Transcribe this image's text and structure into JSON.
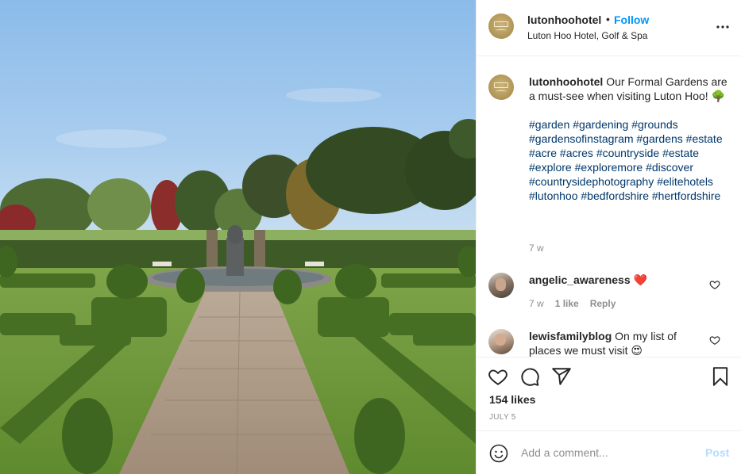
{
  "post": {
    "username": "lutonhoohotel",
    "follow_separator": "•",
    "follow_label": "Follow",
    "location": "Luton Hoo Hotel, Golf & Spa",
    "more_icon": "more-horizontal-icon"
  },
  "caption": {
    "username": "lutonhoohotel",
    "text": "Our Formal Gardens are a must-see when visiting Luton Hoo! 🌳",
    "hashtags": "#garden #gardening #grounds #gardensofinstagram #gardens #estate #acre #acres #countryside #estate #explore #exploremore #discover #countrysidephotography #elitehotels #lutonhoo #bedfordshire #hertfordshire",
    "time": "7 w"
  },
  "comments": [
    {
      "username": "angelic_awareness",
      "text": "❤️",
      "time": "7 w",
      "likes": "1 like",
      "reply_label": "Reply"
    },
    {
      "username": "lewisfamilyblog",
      "text": "On my list of places we must visit 😍"
    }
  ],
  "actions": {
    "likes": "154 likes",
    "date": "JULY 5"
  },
  "add_comment": {
    "placeholder": "Add a comment...",
    "post_label": "Post"
  },
  "colors": {
    "accent": "#0095f6",
    "hashtag": "#00376b",
    "post_disabled": "#b3dbff",
    "muted": "#8e8e8e"
  }
}
